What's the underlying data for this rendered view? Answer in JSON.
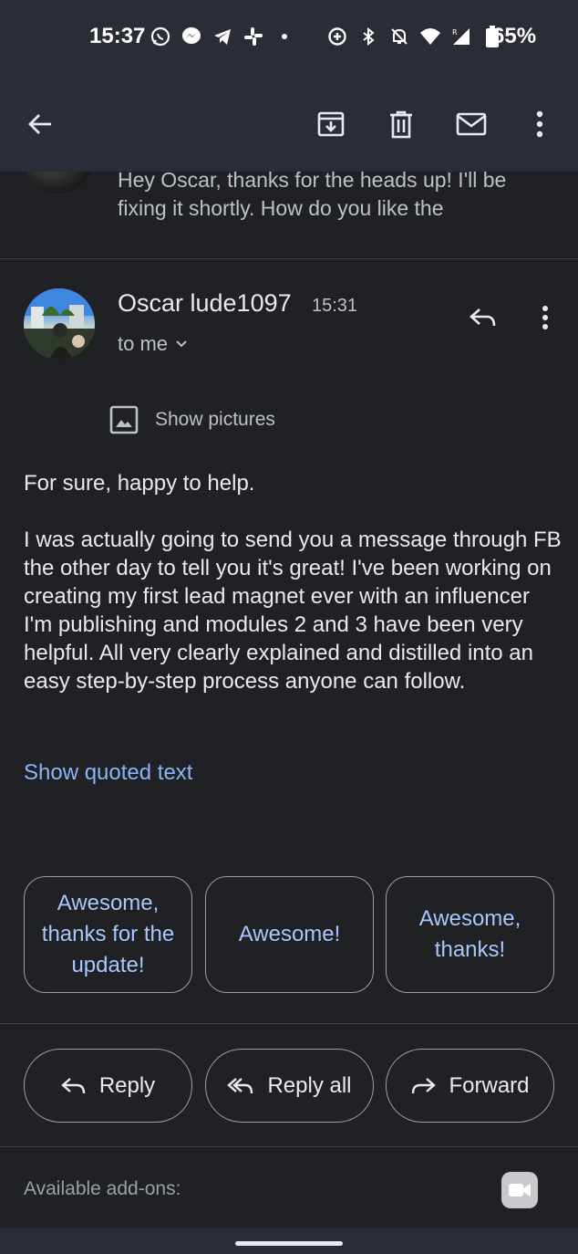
{
  "status_bar": {
    "time": "15:37",
    "battery": "65%",
    "left_icons": [
      "whatsapp-icon",
      "messenger-icon",
      "telegram-icon",
      "slack-icon",
      "dot-icon"
    ],
    "right_icons": [
      "data-saver-icon",
      "bluetooth-icon",
      "mute-icon",
      "wifi-icon",
      "signal-icon",
      "battery-icon"
    ]
  },
  "app_bar": {
    "icons": [
      "back-arrow-icon",
      "archive-icon",
      "delete-icon",
      "mark-unread-icon",
      "more-vert-icon"
    ]
  },
  "previous_message": {
    "snippet": "Hey Oscar, thanks for the heads up! I'll be fixing it shortly. How do you like the"
  },
  "message": {
    "sender": "Oscar lude1097",
    "time": "15:31",
    "recipient": "to me",
    "show_pictures": "Show pictures",
    "paragraphs": [
      "For sure, happy to help.",
      "I was actually going to send you a message through FB the other day to tell you it's great! I've been working on creating my first lead magnet ever with an influencer I'm publishing and modules 2 and 3 have been very helpful. All very clearly explained and distilled into an easy step-by-step process anyone can follow."
    ],
    "show_quoted": "Show quoted text"
  },
  "smart_replies": [
    "Awesome, thanks for the update!",
    "Awesome!",
    "Awesome, thanks!"
  ],
  "actions": {
    "reply": "Reply",
    "reply_all": "Reply all",
    "forward": "Forward"
  },
  "addons": {
    "label": "Available add-ons:"
  },
  "colors": {
    "background": "#202124",
    "bar": "#2a2d35",
    "link": "#8ab4f8",
    "chip_text": "#a8c7fa"
  }
}
